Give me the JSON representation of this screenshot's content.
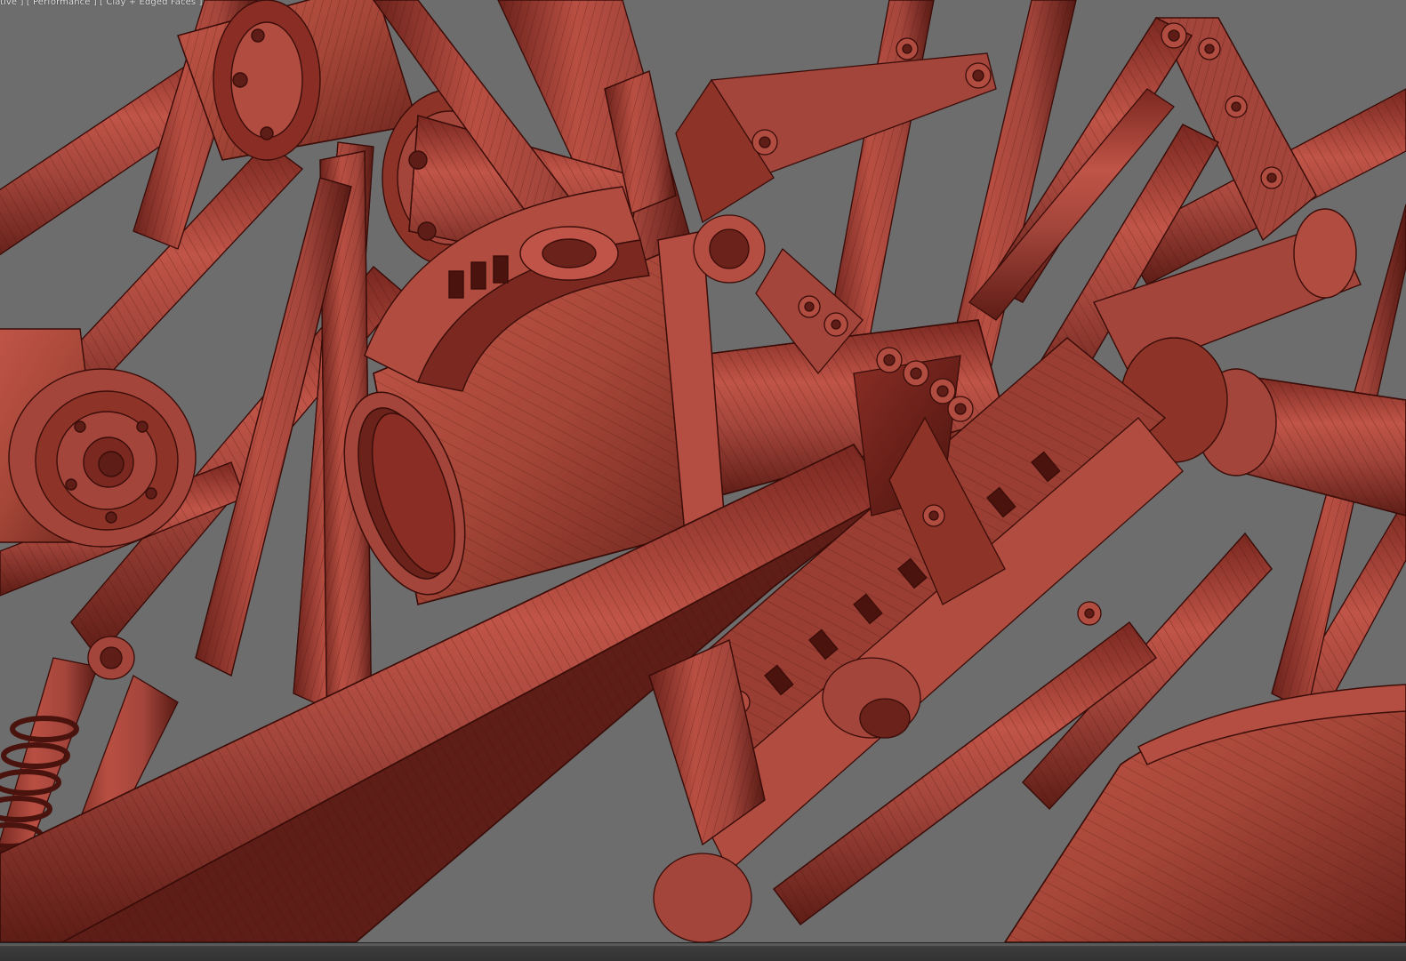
{
  "viewport": {
    "label": "tive ] [ Performance ] [ Clay + Edged Faces ]"
  },
  "colors": {
    "background": "#6d6d6d",
    "clay": "#a3453b",
    "clay_light": "#c4574a",
    "clay_dark": "#5e1d16",
    "edge": "#3a0d09"
  }
}
